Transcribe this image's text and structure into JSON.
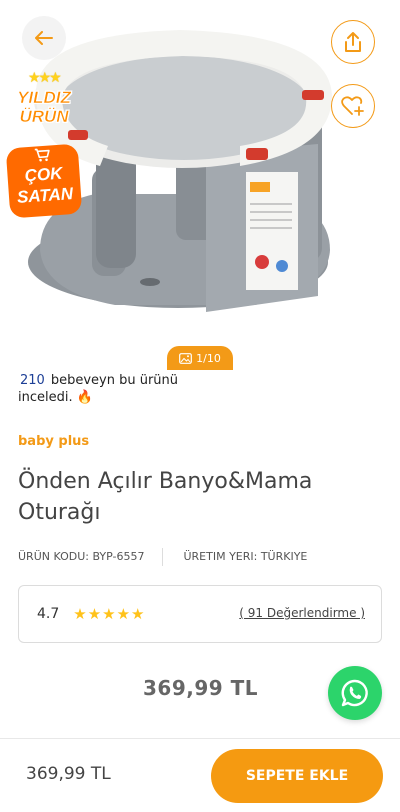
{
  "gallery": {
    "counter": "1/10"
  },
  "badges": {
    "featured": "YILDIZ ÜRÜN",
    "bestseller": "ÇOK SATAN"
  },
  "viewers": {
    "count": "210",
    "text": "bebeveyn bu ürünü inceledi. 🔥"
  },
  "product": {
    "brand": "baby plus",
    "title": "Önden Açılır Banyo&Mama Oturağı",
    "code_label": "ÜRÜN KODU: BYP-6557",
    "origin_label": "ÜRETIM YERI: TÜRKIYE"
  },
  "rating": {
    "value": "4.7",
    "stars": 5,
    "stars_display": "★★★★★",
    "reviews_link": "( 91 Değerlendirme )"
  },
  "price": {
    "current": "369,99 TL"
  },
  "bottom_bar": {
    "price": "369,99 TL",
    "add_to_cart": "SEPETE EKLE"
  },
  "colors": {
    "accent": "#f39a17",
    "brand": "#f39a17",
    "whatsapp": "#2cd46b",
    "link_num": "#1d3f96"
  }
}
